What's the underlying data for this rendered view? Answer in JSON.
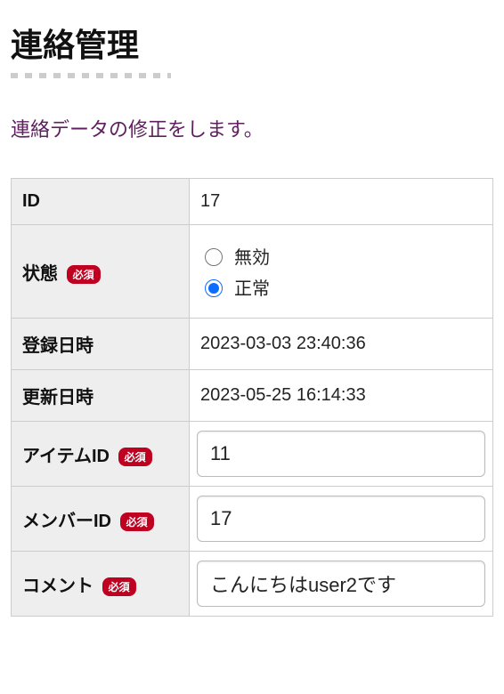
{
  "page": {
    "title": "連絡管理",
    "description": "連絡データの修正をします。"
  },
  "badges": {
    "required": "必須"
  },
  "fields": {
    "id": {
      "label": "ID",
      "value": "17"
    },
    "status": {
      "label": "状態",
      "options": {
        "invalid": "無効",
        "normal": "正常"
      },
      "selected": "normal"
    },
    "created_at": {
      "label": "登録日時",
      "value": "2023-03-03 23:40:36"
    },
    "updated_at": {
      "label": "更新日時",
      "value": "2023-05-25 16:14:33"
    },
    "item_id": {
      "label": "アイテムID",
      "value": "11"
    },
    "member_id": {
      "label": "メンバーID",
      "value": "17"
    },
    "comment": {
      "label": "コメント",
      "value": "こんにちはuser2です"
    }
  }
}
